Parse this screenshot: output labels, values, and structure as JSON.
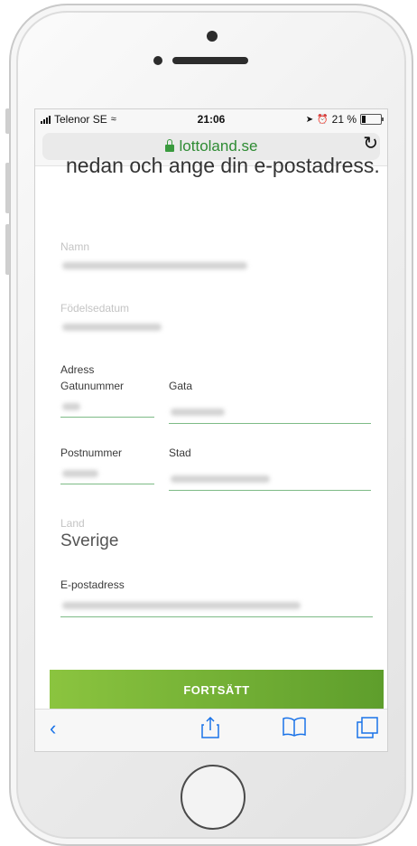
{
  "status_bar": {
    "carrier": "Telenor SE",
    "time": "21:06",
    "battery": "21 %"
  },
  "browser": {
    "url": "lottoland.se"
  },
  "page": {
    "heading_partial": "nedan och ange din e-postadress.",
    "fields": {
      "name_label": "Namn",
      "dob_label": "Födelsedatum",
      "address_label": "Adress",
      "street_number_label": "Gatunummer",
      "street_label": "Gata",
      "postcode_label": "Postnummer",
      "city_label": "Stad",
      "country_label": "Land",
      "country_value": "Sverige",
      "email_label": "E-postadress"
    },
    "continue_button": "FORTSÄTT"
  },
  "icons": [
    "signal-icon",
    "wifi-icon",
    "location-icon",
    "alarm-icon",
    "battery-icon",
    "lock-icon",
    "reload-icon",
    "back-icon",
    "share-icon",
    "bookmarks-icon",
    "tabs-icon"
  ]
}
